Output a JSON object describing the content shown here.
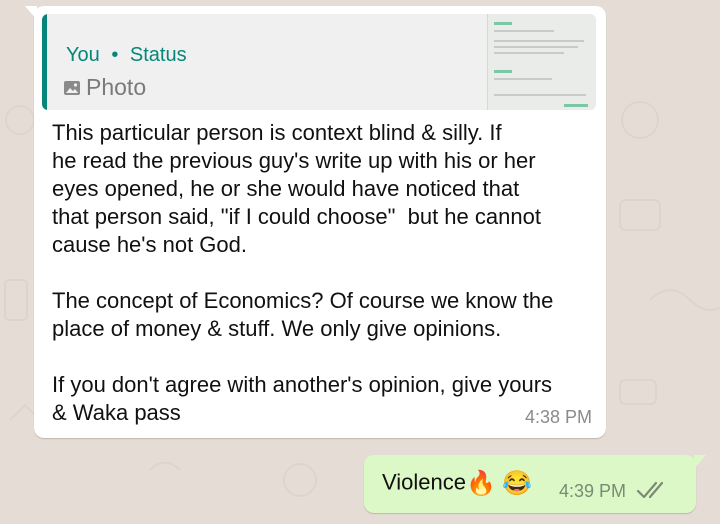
{
  "chat": {
    "incoming": {
      "quote": {
        "author": "You",
        "separator": "•",
        "status_label": "Status",
        "media_label": "Photo",
        "icon": "photo-icon"
      },
      "text": "This particular person is context blind & silly. If\nhe read the previous guy's write up with his or her\neyes opened, he or she would have noticed that\nthat person said, \"if I could choose\"  but he cannot\ncause he's not God.\n\nThe concept of Economics? Of course we know the\nplace of money & stuff. We only give opinions.\n\nIf you don't agree with another's opinion, give yours\n& Waka pass",
      "time": "4:38 PM"
    },
    "outgoing": {
      "text": "Violence",
      "emoji_1": "🔥",
      "emoji_2": "😂",
      "time": "4:39 PM",
      "status_icon": "double-check-icon"
    }
  },
  "colors": {
    "background": "#e5ddd5",
    "incoming_bubble": "#ffffff",
    "outgoing_bubble": "#dcf8c6",
    "quote_accent": "#06867a",
    "tick_color": "#7b8a75"
  }
}
